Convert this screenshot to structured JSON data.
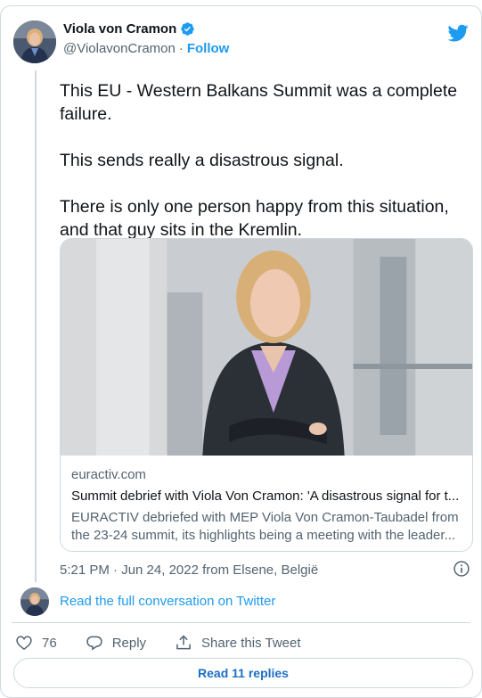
{
  "author": {
    "display_name": "Viola von Cramon",
    "handle": "@ViolavonCramon",
    "separator": "·",
    "follow_label": "Follow"
  },
  "tweet": {
    "paragraphs": [
      "This EU - Western Balkans Summit was a complete failure.",
      "This sends really a disastrous signal.",
      "There is only one person happy from this situation, and that guy sits in the Kremlin."
    ],
    "timestamp": "5:21 PM · Jun 24, 2022 from Elsene, België"
  },
  "link_card": {
    "domain": "euractiv.com",
    "title": "Summit debrief with Viola Von Cramon: 'A disastrous signal for t...",
    "description_line1": "EURACTIV debriefed with MEP Viola Von Cramon-Taubadel from",
    "description_line2": "the 23-24 summit, its highlights being a meeting with the leader..."
  },
  "conversation": {
    "read_full_label": "Read the full conversation on Twitter"
  },
  "actions": {
    "like_count": "76",
    "reply_label": "Reply",
    "share_label": "Share this Tweet"
  },
  "footer": {
    "read_replies_label": "Read 11 replies"
  },
  "colors": {
    "accent": "#1d9bf0",
    "text": "#0f1419",
    "muted": "#536471",
    "border": "#cfd9de"
  },
  "icons": [
    "verified-badge-icon",
    "twitter-bird-icon",
    "info-icon",
    "heart-icon",
    "reply-icon",
    "share-icon"
  ]
}
